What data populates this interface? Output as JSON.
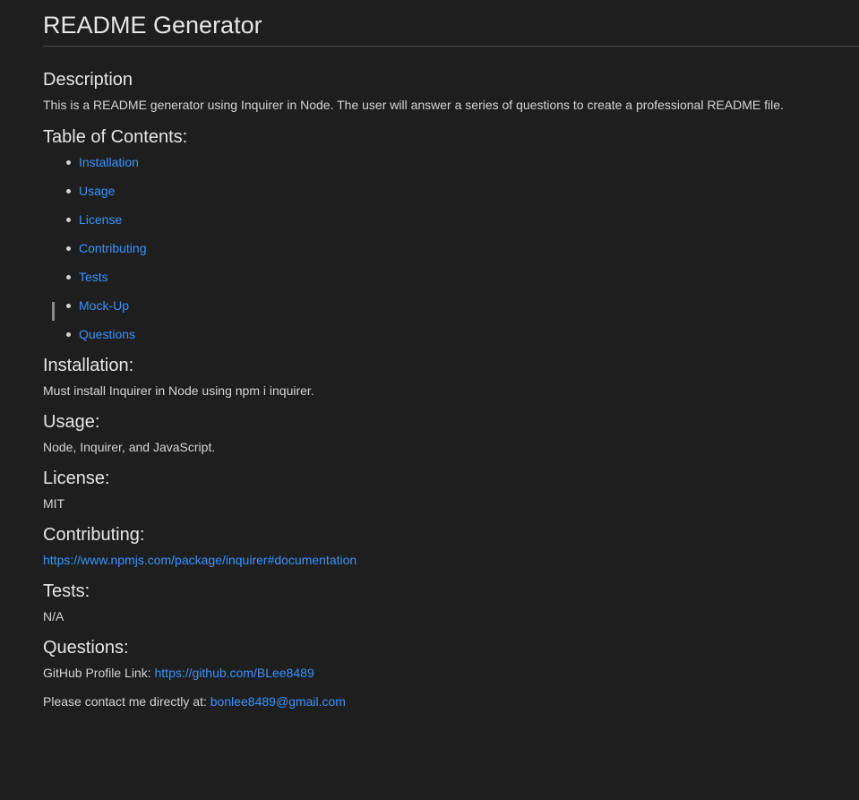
{
  "title": "README Generator",
  "description": {
    "heading": "Description",
    "text": "This is a README generator using Inquirer in Node. The user will answer a series of questions to create a professional README file."
  },
  "toc": {
    "heading": "Table of Contents:",
    "items": [
      "Installation",
      "Usage",
      "License",
      "Contributing",
      "Tests",
      "Mock-Up",
      "Questions"
    ]
  },
  "installation": {
    "heading": "Installation:",
    "text": "Must install Inquirer in Node using npm i inquirer."
  },
  "usage": {
    "heading": "Usage:",
    "text": "Node, Inquirer, and JavaScript."
  },
  "license": {
    "heading": "License:",
    "text": "MIT"
  },
  "contributing": {
    "heading": "Contributing:",
    "link": "https://www.npmjs.com/package/inquirer#documentation"
  },
  "tests": {
    "heading": "Tests:",
    "text": "N/A"
  },
  "questions": {
    "heading": "Questions:",
    "github_label": "GitHub Profile Link: ",
    "github_link": "https://github.com/BLee8489",
    "contact_label": "Please contact me directly at: ",
    "email": "bonlee8489@gmail.com"
  },
  "colors": {
    "background": "#1e1e1e",
    "link": "#3794ff",
    "text": "#d4d4d4"
  }
}
